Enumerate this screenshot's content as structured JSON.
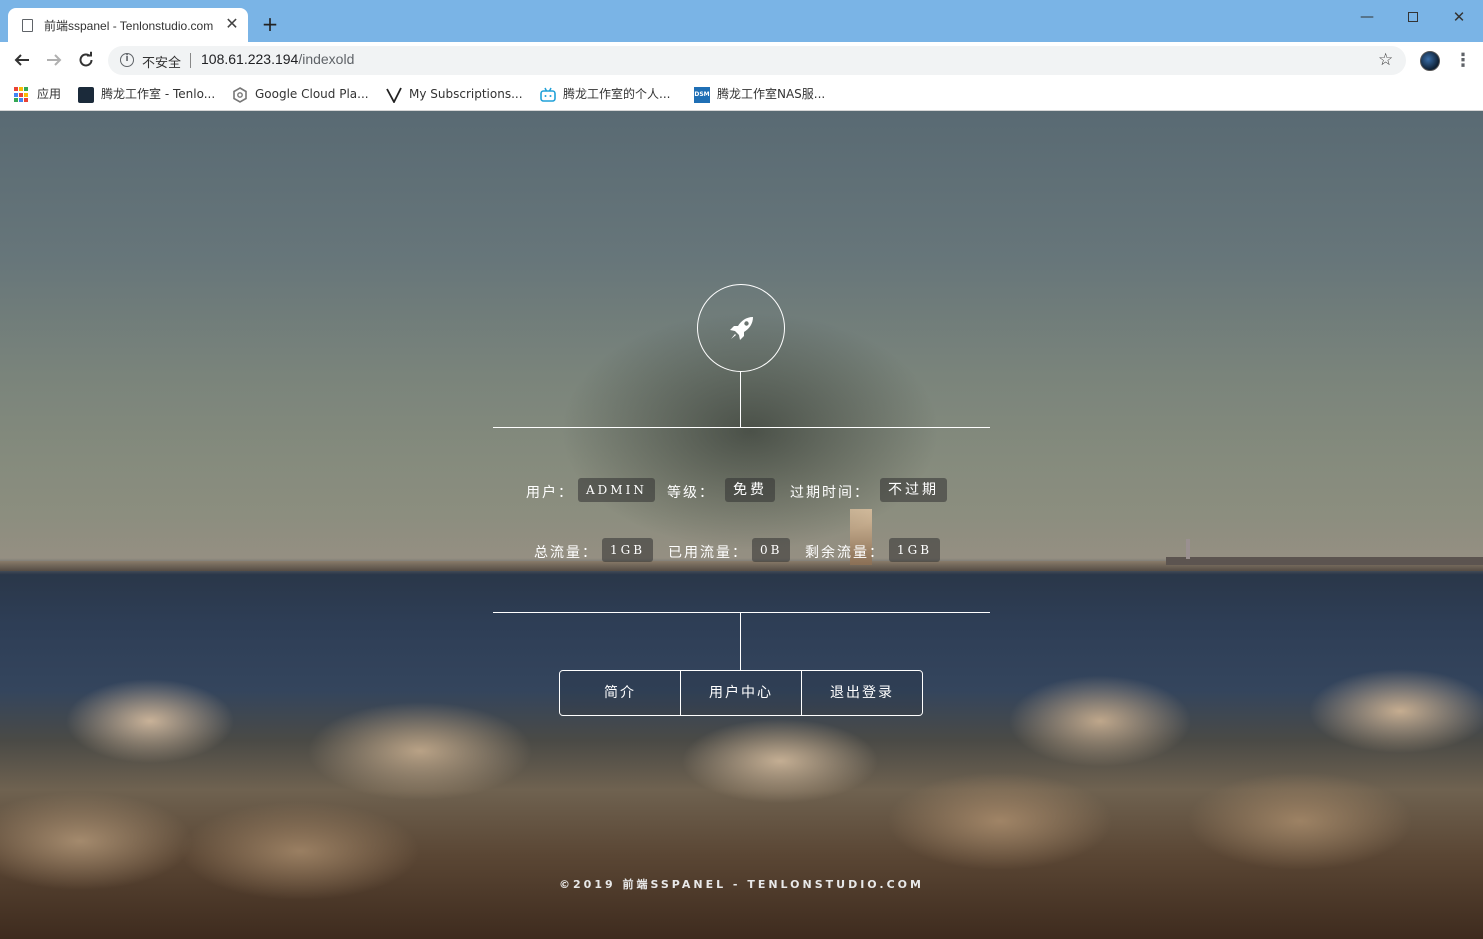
{
  "browser": {
    "tab_title": "前端sspanel - Tenlonstudio.com",
    "tab_close": "✕",
    "new_tab": "+",
    "window_controls": {
      "minimize": "—",
      "close": "✕"
    },
    "security_label": "不安全",
    "url_host": "108.61.223.194",
    "url_path": "/indexold",
    "bookmarks": [
      {
        "label": "应用",
        "icon": "apps-grid-icon"
      },
      {
        "label": "腾龙工作室 - Tenlo...",
        "icon": "site-favicon"
      },
      {
        "label": "Google Cloud Pla...",
        "icon": "google-cloud-icon"
      },
      {
        "label": "My Subscriptions...",
        "icon": "v-logo-icon"
      },
      {
        "label": "腾龙工作室的个人...",
        "icon": "bilibili-icon"
      },
      {
        "label": "腾龙工作室NAS服...",
        "icon": "dsm-icon"
      }
    ]
  },
  "panel": {
    "user_label": "用户：",
    "user_value": "ADMIN",
    "level_label": "等级：",
    "level_value": "免费",
    "expire_label": "过期时间：",
    "expire_value": "不过期",
    "total_label": "总流量：",
    "total_value": "1GB",
    "used_label": "已用流量：",
    "used_value": "0B",
    "remain_label": "剩余流量：",
    "remain_value": "1GB",
    "buttons": [
      "简介",
      "用户中心",
      "退出登录"
    ],
    "footer": "©2019 前端SSPANEL - TENLONSTUDIO.COM"
  },
  "colors": {
    "titlebar": "#7ab4e6",
    "accent_text": "#ffffff"
  }
}
